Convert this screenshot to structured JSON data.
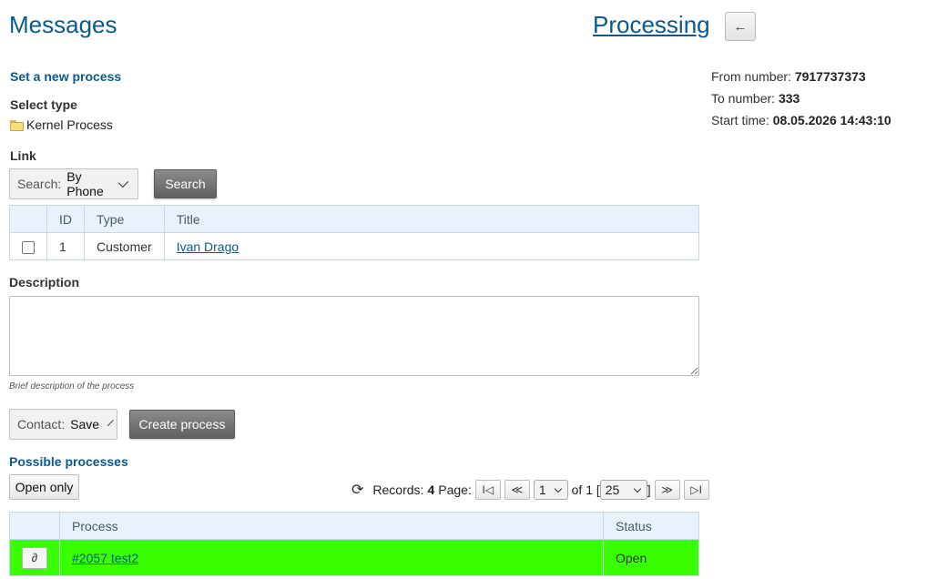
{
  "header": {
    "title": "Messages",
    "link": "Processing",
    "back_icon": "←"
  },
  "form": {
    "set_process": "Set a new process",
    "select_type": "Select type",
    "type_value": "Kernel Process",
    "link_label": "Link",
    "search_key": "Search:",
    "search_value": "By Phone",
    "search_button": "Search",
    "description_label": "Description",
    "description_value": "",
    "description_hint": "Brief description of the process",
    "contact_key": "Contact:",
    "contact_value": "Save",
    "create_button": "Create process"
  },
  "link_table": {
    "headers": [
      "",
      "ID",
      "Type",
      "Title"
    ],
    "rows": [
      {
        "id": "1",
        "type": "Customer",
        "title": "Ivan Drago"
      }
    ]
  },
  "info": {
    "from_label": "From number:",
    "from_value": "7917737373",
    "to_label": "To number:",
    "to_value": "333",
    "start_label": "Start time:",
    "start_value": "08.05.2026 14:43:10"
  },
  "possible": {
    "title": "Possible processes",
    "open_only": "Open only",
    "records_label": "Records:",
    "records_value": "4",
    "page_label": "Page:",
    "page_value": "1",
    "of_label": "of 1 [",
    "close_bracket": "]",
    "page_size": "25",
    "headers": [
      "",
      "Process",
      "Status"
    ],
    "rows": [
      {
        "process": "#2057 test2",
        "status": "Open",
        "color": "#39ff00"
      }
    ]
  },
  "icons": {
    "refresh": "⟳",
    "first": "I◁",
    "prev": "≪",
    "next": "≫",
    "last": "▷I",
    "link": "∂"
  }
}
